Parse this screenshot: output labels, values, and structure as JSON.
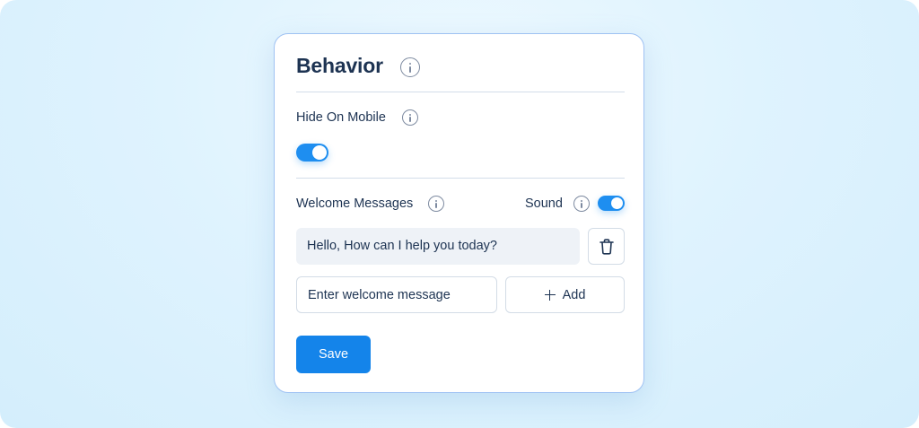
{
  "behavior": {
    "title": "Behavior",
    "hide_on_mobile": {
      "label": "Hide On Mobile",
      "enabled": true
    },
    "welcome_messages": {
      "label": "Welcome Messages",
      "sound": {
        "label": "Sound",
        "enabled": true
      },
      "messages": [
        "Hello, How can I help you today?"
      ],
      "input": {
        "value": "",
        "placeholder": "Enter welcome message"
      },
      "add_label": "Add"
    },
    "save_label": "Save"
  },
  "colors": {
    "accent": "#1e8ef0",
    "text": "#1d3352",
    "border": "#9fc2f3"
  },
  "icons": [
    "info-icon",
    "trash-icon",
    "plus-icon"
  ]
}
